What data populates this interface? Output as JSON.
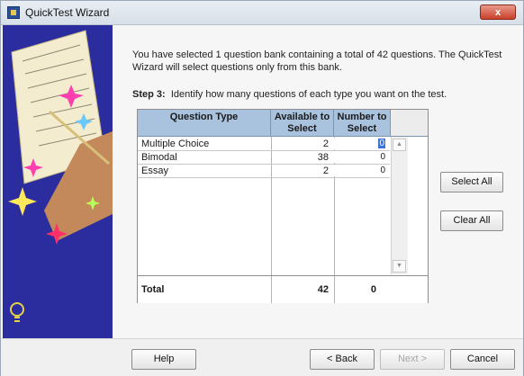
{
  "window": {
    "title": "QuickTest Wizard",
    "close_glyph": "x"
  },
  "intro": {
    "text": "You have selected 1 question bank containing a total of 42 questions.  The QuickTest Wizard will select questions only from this bank."
  },
  "step": {
    "label": "Step 3:",
    "text": "Identify how many questions of each type you want on the test."
  },
  "table": {
    "headers": {
      "type": "Question Type",
      "available": "Available to Select",
      "number": "Number to Select"
    },
    "rows": [
      {
        "type": "Multiple Choice",
        "available": "2",
        "number": "0"
      },
      {
        "type": "Bimodal",
        "available": "38",
        "number": "0"
      },
      {
        "type": "Essay",
        "available": "2",
        "number": "0"
      }
    ],
    "total": {
      "label": "Total",
      "available": "42",
      "number": "0"
    }
  },
  "buttons": {
    "select_all": "Select All",
    "clear_all": "Clear All",
    "help": "Help",
    "back": "< Back",
    "next": "Next >",
    "cancel": "Cancel"
  },
  "colors": {
    "side_panel": "#2b2c9d",
    "header_bg": "#a9c2dd",
    "selection": "#3a74d8",
    "close_button": "#c9402a"
  },
  "icons": {
    "app": "quicktest-app-icon",
    "close": "close-icon",
    "scroll_up": "scroll-up-arrow-icon",
    "scroll_down": "scroll-down-arrow-icon",
    "lightbulb": "lightbulb-icon"
  }
}
